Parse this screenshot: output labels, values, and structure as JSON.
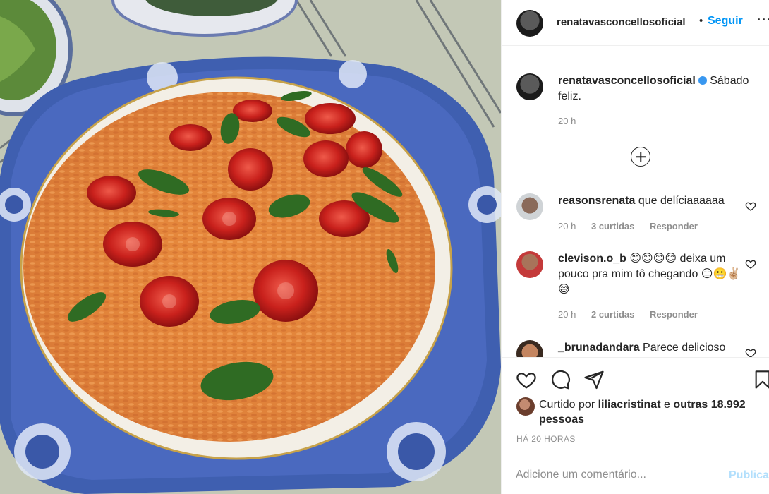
{
  "post": {
    "photo_alt": "",
    "header": {
      "username": "renatavasconcellosoficial",
      "separator": "•",
      "follow_label": "Seguir",
      "more_label": "···"
    },
    "caption": {
      "username": "renatavasconcellosoficial",
      "text": "Sábado feliz.",
      "time": "20 h"
    },
    "comments": [
      {
        "username": "reasonsrenata",
        "text": "que delíciaaaaaa",
        "time": "20 h",
        "likes": "3 curtidas",
        "reply": "Responder"
      },
      {
        "username": "clevison.o_b",
        "text": "😊😊😊😊 deixa um pouco pra mim tô chegando 😑😬✌🏼😅",
        "time": "20 h",
        "likes": "2 curtidas",
        "reply": "Responder"
      },
      {
        "username": "_brunadandara",
        "text": "Parece delicioso"
      }
    ],
    "likes": {
      "prefix": "Curtido por",
      "user": "liliacristinat",
      "conj": "e",
      "others": "outras 18.992 pessoas"
    },
    "time_ago": "HÁ 20 HORAS",
    "add_comment": {
      "placeholder": "Adicione um comentário...",
      "publish_label": "Publicar"
    }
  },
  "icons": {
    "like": "heart-icon",
    "comment": "comment-icon",
    "share": "paper-plane-icon",
    "save": "bookmark-icon",
    "load_more": "plus-circle-icon",
    "verified": "verified-badge-icon"
  },
  "colors": {
    "link": "#0095f6",
    "muted": "#8e8e8e",
    "text": "#262626",
    "publish_disabled": "#b2dffc"
  }
}
